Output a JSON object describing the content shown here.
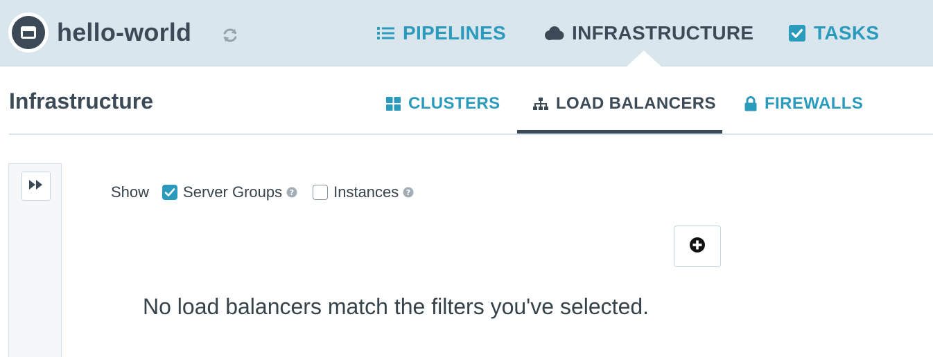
{
  "app": {
    "title": "hello-world",
    "logo_icon": "window-icon",
    "refresh_icon": "refresh-icon"
  },
  "main_nav": {
    "items": [
      {
        "label": "PIPELINES",
        "icon": "list-icon",
        "active": false
      },
      {
        "label": "INFRASTRUCTURE",
        "icon": "cloud-icon",
        "active": true
      },
      {
        "label": "TASKS",
        "icon": "check-square-icon",
        "active": false
      }
    ]
  },
  "page": {
    "title": "Infrastructure"
  },
  "sub_tabs": {
    "items": [
      {
        "label": "CLUSTERS",
        "icon": "grid-icon",
        "active": false
      },
      {
        "label": "LOAD BALANCERS",
        "icon": "sitemap-icon",
        "active": true
      },
      {
        "label": "FIREWALLS",
        "icon": "lock-icon",
        "active": false
      }
    ]
  },
  "filters": {
    "show_label": "Show",
    "options": [
      {
        "label": "Server Groups",
        "checked": true,
        "help_icon": "question-circle-icon"
      },
      {
        "label": "Instances",
        "checked": false,
        "help_icon": "question-circle-icon"
      }
    ]
  },
  "empty_state": {
    "message": "No load balancers match the filters you've selected."
  },
  "colors": {
    "accent": "#2a9bbd",
    "dark": "#3b4a56",
    "header_bg": "#d9e6ee"
  }
}
